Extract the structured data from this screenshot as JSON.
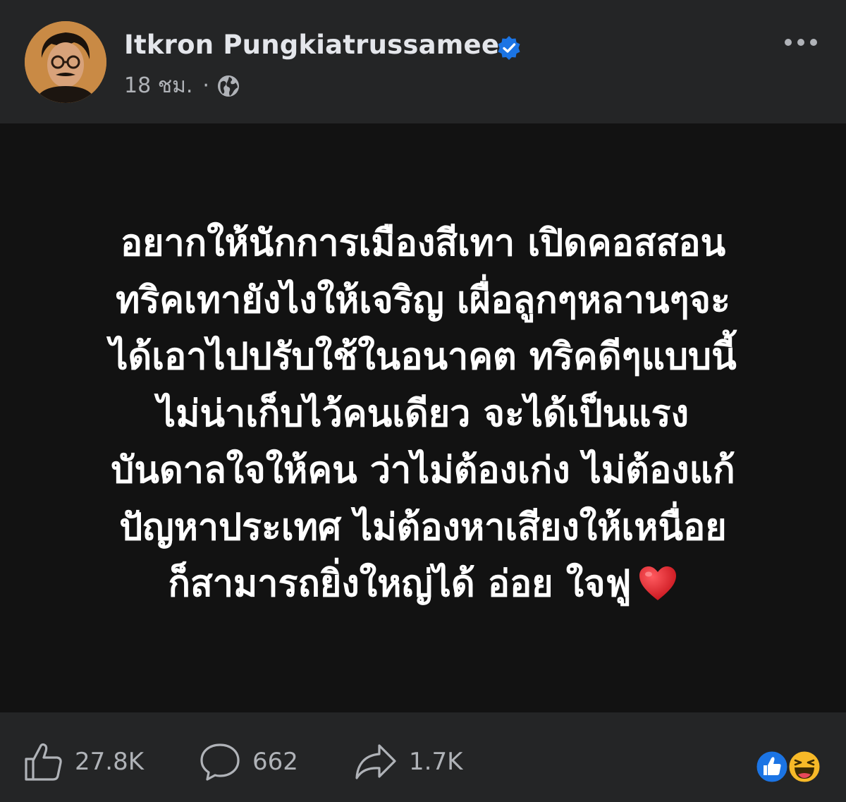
{
  "post": {
    "author": {
      "name": "Itkron Pungkiatrussamee",
      "verified": true
    },
    "timestamp": "18 ชม.",
    "separator": "·",
    "audience_icon": "globe-icon",
    "menu_icon": "more-horizontal-icon",
    "background_color": "#121212",
    "text_lines": [
      "อยากให้นักการเมืองสีเทา เปิดคอสสอน",
      "ทริคเทายังไงให้เจริญ เผื่อลูกๆหลานๆจะ",
      "ได้เอาไปปรับใช้ในอนาคต ทริคดีๆแบบนี้",
      "ไม่น่าเก็บไว้คนเดียว จะได้เป็นแรง",
      "บันดาลใจให้คน ว่าไม่ต้องเก่ง ไม่ต้องแก้",
      "ปัญหาประเทศ ไม่ต้องหาเสียงให้เหนื่อย",
      "ก็สามารถยิ่งใหญ่ได้ อ่อย ใจฟู"
    ],
    "trailing_emoji": "red-heart-icon"
  },
  "footer": {
    "likes": "27.8K",
    "comments": "662",
    "shares": "1.7K",
    "reactions": [
      "like-reaction-icon",
      "haha-reaction-icon"
    ]
  },
  "colors": {
    "surface": "#242526",
    "post_background": "#121212",
    "primary_text": "#e4e6eb",
    "secondary_text": "#b0b3b8",
    "verified_blue": "#1b74e4",
    "heart_red": "#e0242b",
    "haha_yellow": "#f7b928"
  }
}
